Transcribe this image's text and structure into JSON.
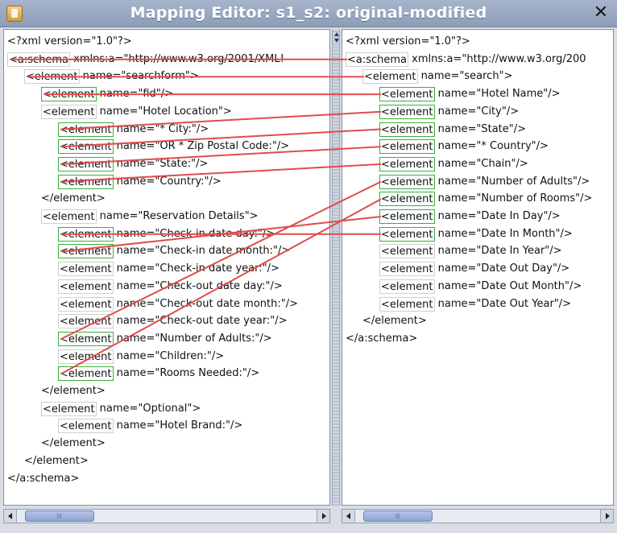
{
  "window": {
    "title": "Mapping Editor: s1_s2: original-modified",
    "close_glyph": "✕"
  },
  "left_pane": {
    "lines": [
      {
        "indent": 0,
        "element": "",
        "text": "<?xml version=\"1.0\"?>"
      },
      {
        "indent": 0,
        "element": "<a:schema",
        "text": " xmlns:a=\"http://www.w3.org/2001/XML!"
      },
      {
        "indent": 1,
        "element": "<element",
        "text": " name=\"searchform\">"
      },
      {
        "indent": 2,
        "element": "<element",
        "text": " name=\"fid\"/>"
      },
      {
        "indent": 2,
        "element": "<element",
        "text": " name=\"Hotel Location\">"
      },
      {
        "indent": 3,
        "element": "<element",
        "text": " name=\"* City:\"/>"
      },
      {
        "indent": 3,
        "element": "<element",
        "text": " name=\"OR * Zip Postal Code:\"/>"
      },
      {
        "indent": 3,
        "element": "<element",
        "text": " name=\"State:\"/>"
      },
      {
        "indent": 3,
        "element": "<element",
        "text": " name=\"Country:\"/>"
      },
      {
        "indent": 2,
        "element": "",
        "text": "</element>"
      },
      {
        "indent": 2,
        "element": "<element",
        "text": " name=\"Reservation Details\">"
      },
      {
        "indent": 3,
        "element": "<element",
        "text": " name=\"Check-in date day:\"/>"
      },
      {
        "indent": 3,
        "element": "<element",
        "text": " name=\"Check-in date month:\"/>"
      },
      {
        "indent": 3,
        "element": "<element",
        "text": " name=\"Check-in date year:\"/>"
      },
      {
        "indent": 3,
        "element": "<element",
        "text": " name=\"Check-out date day:\"/>"
      },
      {
        "indent": 3,
        "element": "<element",
        "text": " name=\"Check-out date month:\"/>"
      },
      {
        "indent": 3,
        "element": "<element",
        "text": " name=\"Check-out date year:\"/>"
      },
      {
        "indent": 3,
        "element": "<element",
        "text": " name=\"Number of Adults:\"/>"
      },
      {
        "indent": 3,
        "element": "<element",
        "text": " name=\"Children:\"/>"
      },
      {
        "indent": 3,
        "element": "<element",
        "text": " name=\"Rooms Needed:\"/>"
      },
      {
        "indent": 2,
        "element": "",
        "text": "</element>"
      },
      {
        "indent": 2,
        "element": "<element",
        "text": " name=\"Optional\">"
      },
      {
        "indent": 3,
        "element": "<element",
        "text": " name=\"Hotel Brand:\"/>"
      },
      {
        "indent": 2,
        "element": "",
        "text": "</element>"
      },
      {
        "indent": 1,
        "element": "",
        "text": "</element>"
      },
      {
        "indent": 0,
        "element": "",
        "text": "</a:schema>"
      }
    ]
  },
  "right_pane": {
    "lines": [
      {
        "indent": 0,
        "element": "",
        "text": "<?xml version=\"1.0\"?>"
      },
      {
        "indent": 0,
        "element": "<a:schema",
        "text": " xmlns:a=\"http://www.w3.org/200"
      },
      {
        "indent": 1,
        "element": "<element",
        "text": " name=\"search\">"
      },
      {
        "indent": 2,
        "element": "<element",
        "text": " name=\"Hotel Name\"/>"
      },
      {
        "indent": 2,
        "element": "<element",
        "text": " name=\"City\"/>"
      },
      {
        "indent": 2,
        "element": "<element",
        "text": " name=\"State\"/>"
      },
      {
        "indent": 2,
        "element": "<element",
        "text": " name=\"* Country\"/>"
      },
      {
        "indent": 2,
        "element": "<element",
        "text": " name=\"Chain\"/>"
      },
      {
        "indent": 2,
        "element": "<element",
        "text": " name=\"Number of Adults\"/>"
      },
      {
        "indent": 2,
        "element": "<element",
        "text": " name=\"Number of Rooms\"/>"
      },
      {
        "indent": 2,
        "element": "<element",
        "text": " name=\"Date In Day\"/>"
      },
      {
        "indent": 2,
        "element": "<element",
        "text": " name=\"Date In Month\"/>"
      },
      {
        "indent": 2,
        "element": "<element",
        "text": " name=\"Date In Year\"/>"
      },
      {
        "indent": 2,
        "element": "<element",
        "text": " name=\"Date Out Day\"/>"
      },
      {
        "indent": 2,
        "element": "<element",
        "text": " name=\"Date Out Month\"/>"
      },
      {
        "indent": 2,
        "element": "<element",
        "text": " name=\"Date Out Year\"/>"
      },
      {
        "indent": 1,
        "element": "",
        "text": "</element>"
      },
      {
        "indent": 0,
        "element": "",
        "text": "</a:schema>"
      }
    ]
  },
  "mappings": [
    {
      "left": "a:schema",
      "right": "a:schema"
    },
    {
      "left": "searchform",
      "right": "search"
    },
    {
      "left": "fid",
      "right": "Hotel Name"
    },
    {
      "left": "* City:",
      "right": "City"
    },
    {
      "left": "OR * Zip Postal Code:",
      "right": "State"
    },
    {
      "left": "State:",
      "right": "* Country"
    },
    {
      "left": "Country:",
      "right": "Chain"
    },
    {
      "left": "Check-in date day:",
      "right": "Date In Month"
    },
    {
      "left": "Check-in date month:",
      "right": "Date In Day"
    },
    {
      "left": "Number of Adults:",
      "right": "Number of Adults"
    },
    {
      "left": "Rooms Needed:",
      "right": "Number of Rooms"
    }
  ],
  "colors": {
    "mapping_line": "#e24b4b",
    "mapped_border": "#3cae3c",
    "unmapped_border": "#cfcfcf"
  }
}
